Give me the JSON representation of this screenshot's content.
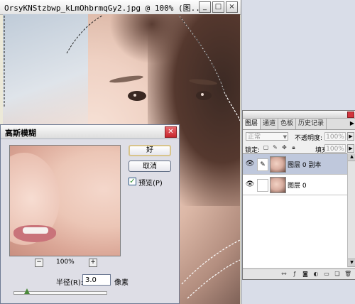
{
  "document": {
    "title": "OrsyKNStzbwp_kLmOhbrmqGy2.jpg @ 100% (图...",
    "buttons": {
      "minimize": "_",
      "maximize": "□",
      "close": "×"
    }
  },
  "layers_panel": {
    "tabs": [
      "图层",
      "通道",
      "色板",
      "历史记录"
    ],
    "active_tab": "图层",
    "blend_mode": "正常",
    "opacity_label": "不透明度:",
    "opacity_value": "100%",
    "lock_label": "锁定:",
    "fill_label": "填充:",
    "fill_value": "100%",
    "layers": [
      {
        "name": "图层 0 副本",
        "selected": true,
        "link": "✎"
      },
      {
        "name": "图层 0",
        "selected": false,
        "link": ""
      }
    ],
    "icons": [
      "link-icon",
      "layer-style-icon",
      "mask-icon",
      "adjustment-icon",
      "group-icon",
      "new-layer-icon",
      "trash-icon"
    ]
  },
  "dialog": {
    "title": "高斯模糊",
    "ok_label": "好",
    "cancel_label": "取消",
    "preview_label": "预览(P)",
    "preview_checked": true,
    "zoom_level": "100%",
    "zoom_out": "−",
    "zoom_in": "+",
    "radius_label": "半径(R):",
    "radius_value": "3.0",
    "radius_unit": "像素"
  }
}
